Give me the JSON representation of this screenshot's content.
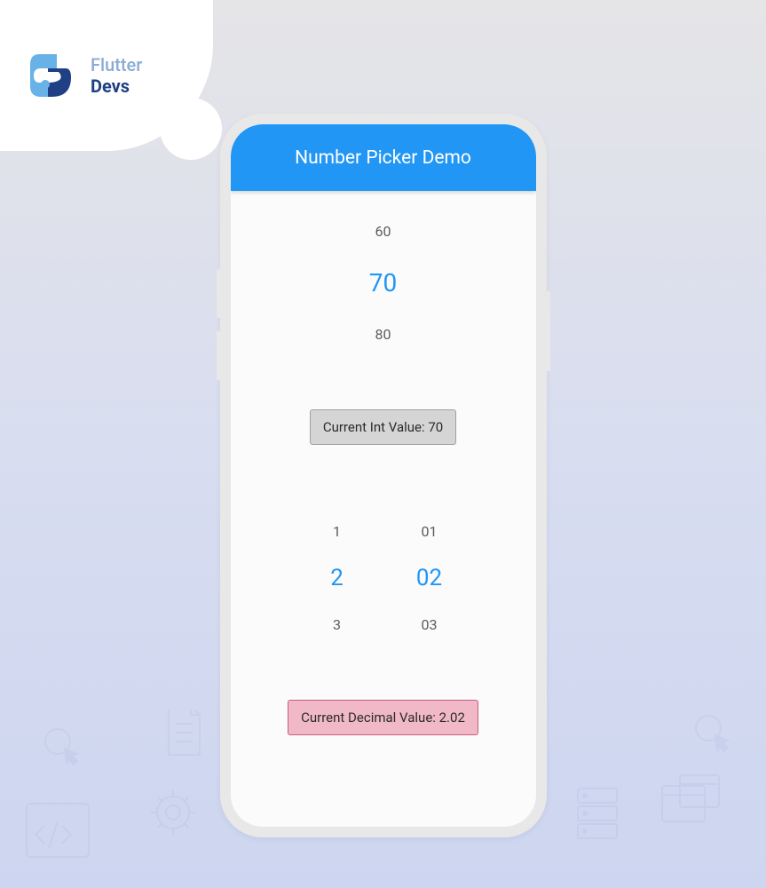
{
  "logo": {
    "line1": "Flutter",
    "line2": "Devs"
  },
  "appBar": {
    "title": "Number Picker Demo"
  },
  "intPicker": {
    "prev": "60",
    "current": "70",
    "next": "80"
  },
  "intBadge": {
    "text": "Current Int Value: 70"
  },
  "decimalPicker": {
    "whole": {
      "prev": "1",
      "current": "2",
      "next": "3"
    },
    "fraction": {
      "prev": "01",
      "current": "02",
      "next": "03"
    }
  },
  "decimalBadge": {
    "text": "Current Decimal Value: 2.02"
  }
}
